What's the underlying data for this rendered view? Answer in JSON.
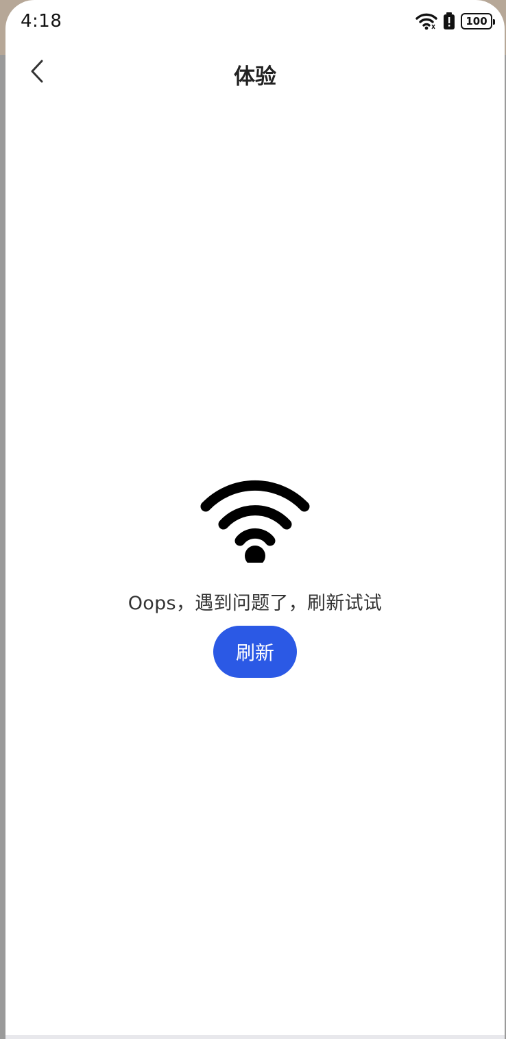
{
  "status_bar": {
    "time": "4:18",
    "battery": "100",
    "wifi_icon": "wifi-icon",
    "alert_icon": "battery-saver-icon"
  },
  "nav": {
    "title": "体验",
    "back_icon": "chevron-left-icon"
  },
  "error": {
    "illustration_icon": "wifi-icon",
    "message": "Oops，遇到问题了，刷新试试",
    "refresh_label": "刷新"
  },
  "colors": {
    "accent": "#2b59e5",
    "background": "#ffffff",
    "text": "#333333"
  }
}
